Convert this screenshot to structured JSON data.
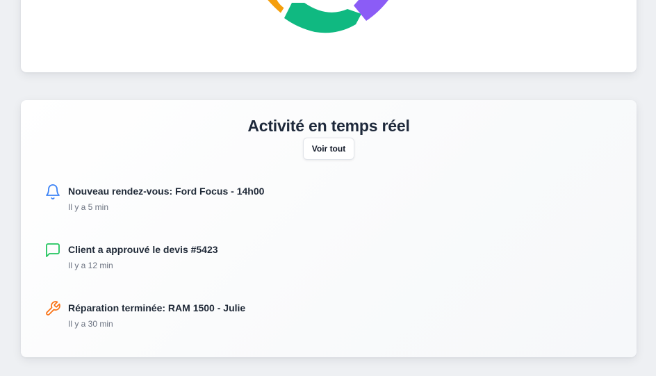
{
  "colors": {
    "segment_orange": "#f59e0b",
    "segment_green": "#10b981",
    "segment_purple": "#8b5cf6",
    "bell": "#3b82f6",
    "message": "#22c55e",
    "wrench": "#f97316"
  },
  "activity": {
    "title": "Activité en temps réel",
    "view_all": "Voir tout",
    "items": [
      {
        "icon": "bell-icon",
        "text": "Nouveau rendez-vous: Ford Focus - 14h00",
        "time": "Il y a 5 min"
      },
      {
        "icon": "message-icon",
        "text": "Client a approuvé le devis #5423",
        "time": "Il y a 12 min"
      },
      {
        "icon": "wrench-icon",
        "text": "Réparation terminée: RAM 1500 - Julie",
        "time": "Il y a 30 min"
      }
    ]
  }
}
